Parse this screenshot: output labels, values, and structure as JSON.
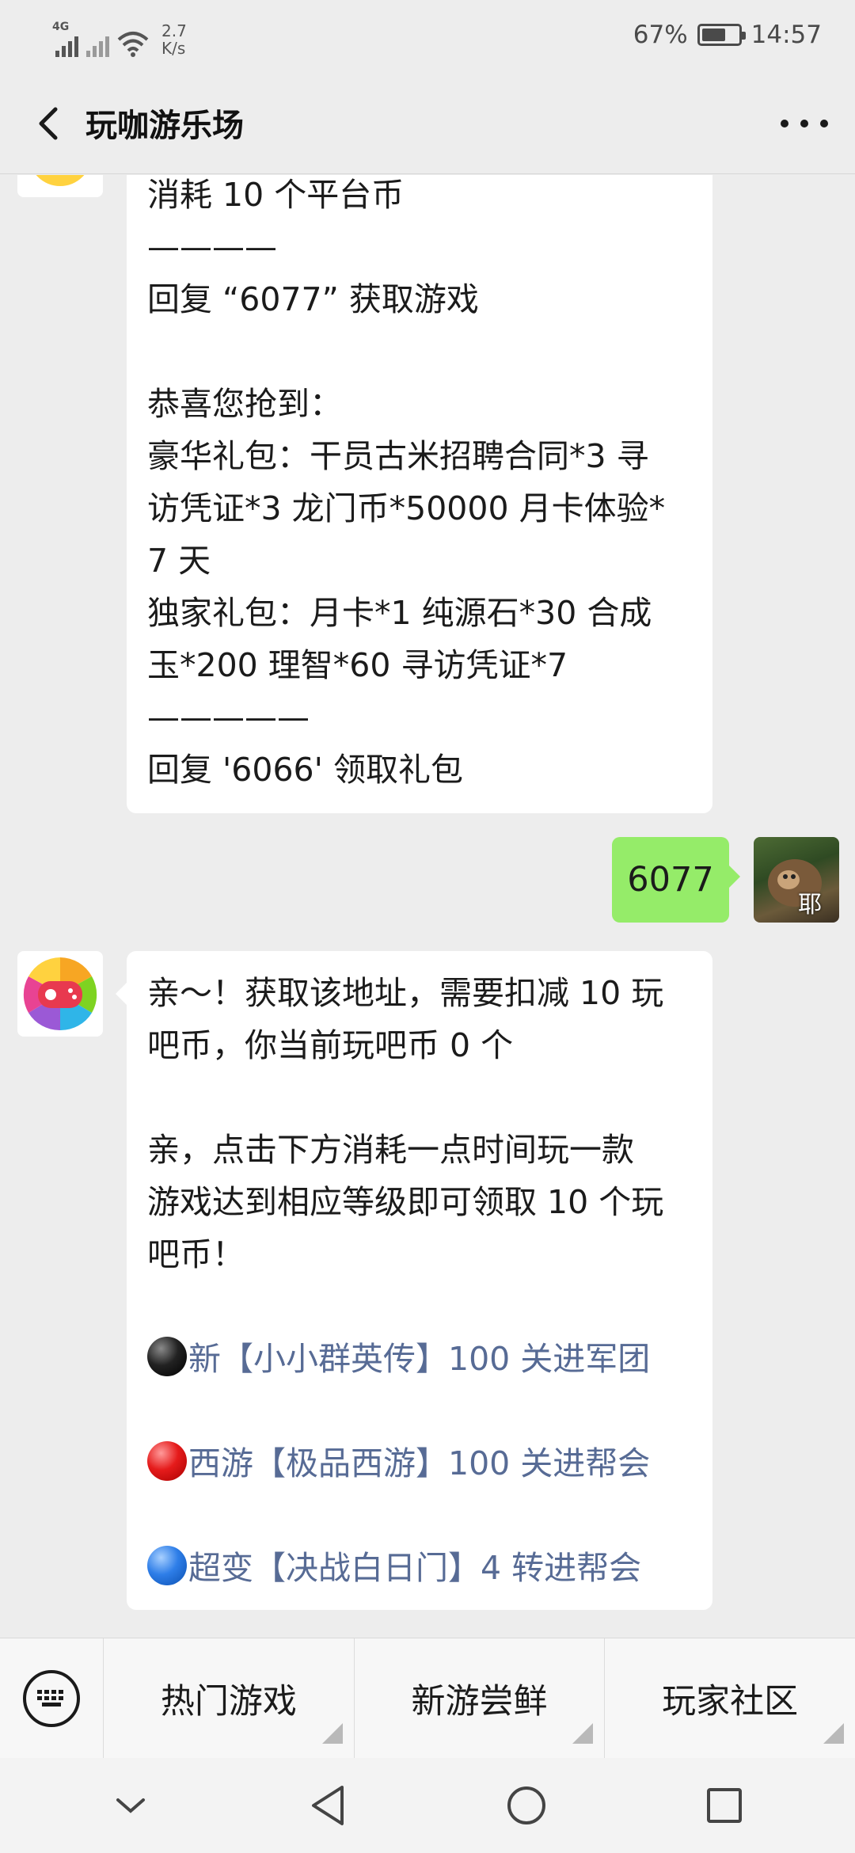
{
  "status_bar": {
    "net_type": "4G",
    "speed_value": "2.7",
    "speed_unit": "K/s",
    "battery_pct": "67%",
    "battery_level": 0.67,
    "time": "14:57"
  },
  "header": {
    "title": "玩咖游乐场"
  },
  "messages": {
    "first_bot": {
      "lines": [
        "消耗 10 个平台币",
        "————",
        "回复 “6077” 获取游戏",
        "",
        "恭喜您抢到：",
        "豪华礼包：干员古米招聘合同*3 寻",
        "访凭证*3 龙门币*50000 月卡体验*",
        "7 天",
        "独家礼包：月卡*1 纯源石*30 合成",
        "玉*200 理智*60 寻访凭证*7",
        "—————",
        "回复 '6066' 领取礼包"
      ]
    },
    "user_reply": {
      "text": "6077",
      "avatar_char": "耶"
    },
    "second_bot": {
      "p1_l1": "亲～！获取该地址，需要扣减 10 玩",
      "p1_l2": "吧币，你当前玩吧币 0 个",
      "p2_l1": "亲，点击下方消耗一点时间玩一款",
      "p2_l2": "游戏达到相应等级即可领取 10 个玩",
      "p2_l3": "吧币！",
      "link1": "新【小小群英传】100 关进军团",
      "link2": "西游【极品西游】100 关进帮会",
      "link3": "超变【决战白日门】4 转进帮会"
    }
  },
  "bottom_menu": {
    "items": [
      "热门游戏",
      "新游尝鲜",
      "玩家社区"
    ]
  },
  "colors": {
    "bg": "#ededed",
    "bubble_user": "#95ec69",
    "link": "#576b95"
  }
}
